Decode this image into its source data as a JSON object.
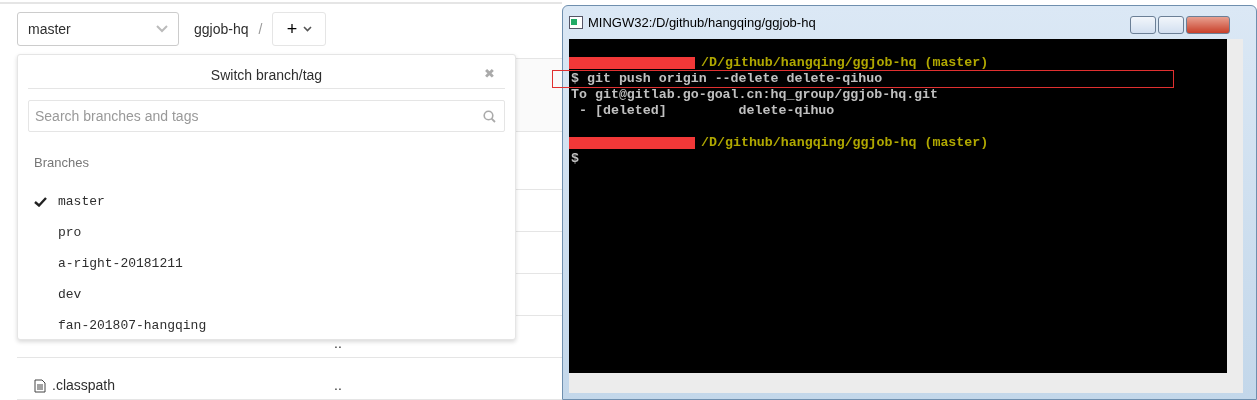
{
  "branch_select": {
    "value": "master"
  },
  "breadcrumb": {
    "project": "ggjob-hq",
    "separator": "/",
    "add_button": "+"
  },
  "dropdown": {
    "title": "Switch branch/tag",
    "close": "✖",
    "search": {
      "placeholder": "Search branches and tags"
    },
    "section": "Branches",
    "branches": [
      {
        "name": "master",
        "selected": true
      },
      {
        "name": "pro",
        "selected": false
      },
      {
        "name": "a-right-20181211",
        "selected": false
      },
      {
        "name": "dev",
        "selected": false
      },
      {
        "name": "fan-201807-hangqing",
        "selected": false
      }
    ]
  },
  "files": [
    {
      "kind": "covered",
      "last_commit": ".."
    },
    {
      "kind": "file",
      "name": ".classpath",
      "last_commit": ".."
    }
  ],
  "terminal": {
    "title": "MINGW32:/D/github/hangqing/ggjob-hq",
    "lines": [
      {
        "kind": "blank"
      },
      {
        "kind": "prompt",
        "text": "/D/github/hangqing/ggjob-hq (master)"
      },
      {
        "kind": "command",
        "text": "$ git push origin --delete delete-qihuo",
        "highlighted": true
      },
      {
        "kind": "output",
        "text": "To git@gitlab.go-goal.cn:hq_group/ggjob-hq.git"
      },
      {
        "kind": "output",
        "text": " - [deleted]         delete-qihuo"
      },
      {
        "kind": "blank"
      },
      {
        "kind": "prompt",
        "text": "/D/github/hangqing/ggjob-hq (master)"
      },
      {
        "kind": "command",
        "text": "$",
        "highlighted": false
      }
    ]
  }
}
